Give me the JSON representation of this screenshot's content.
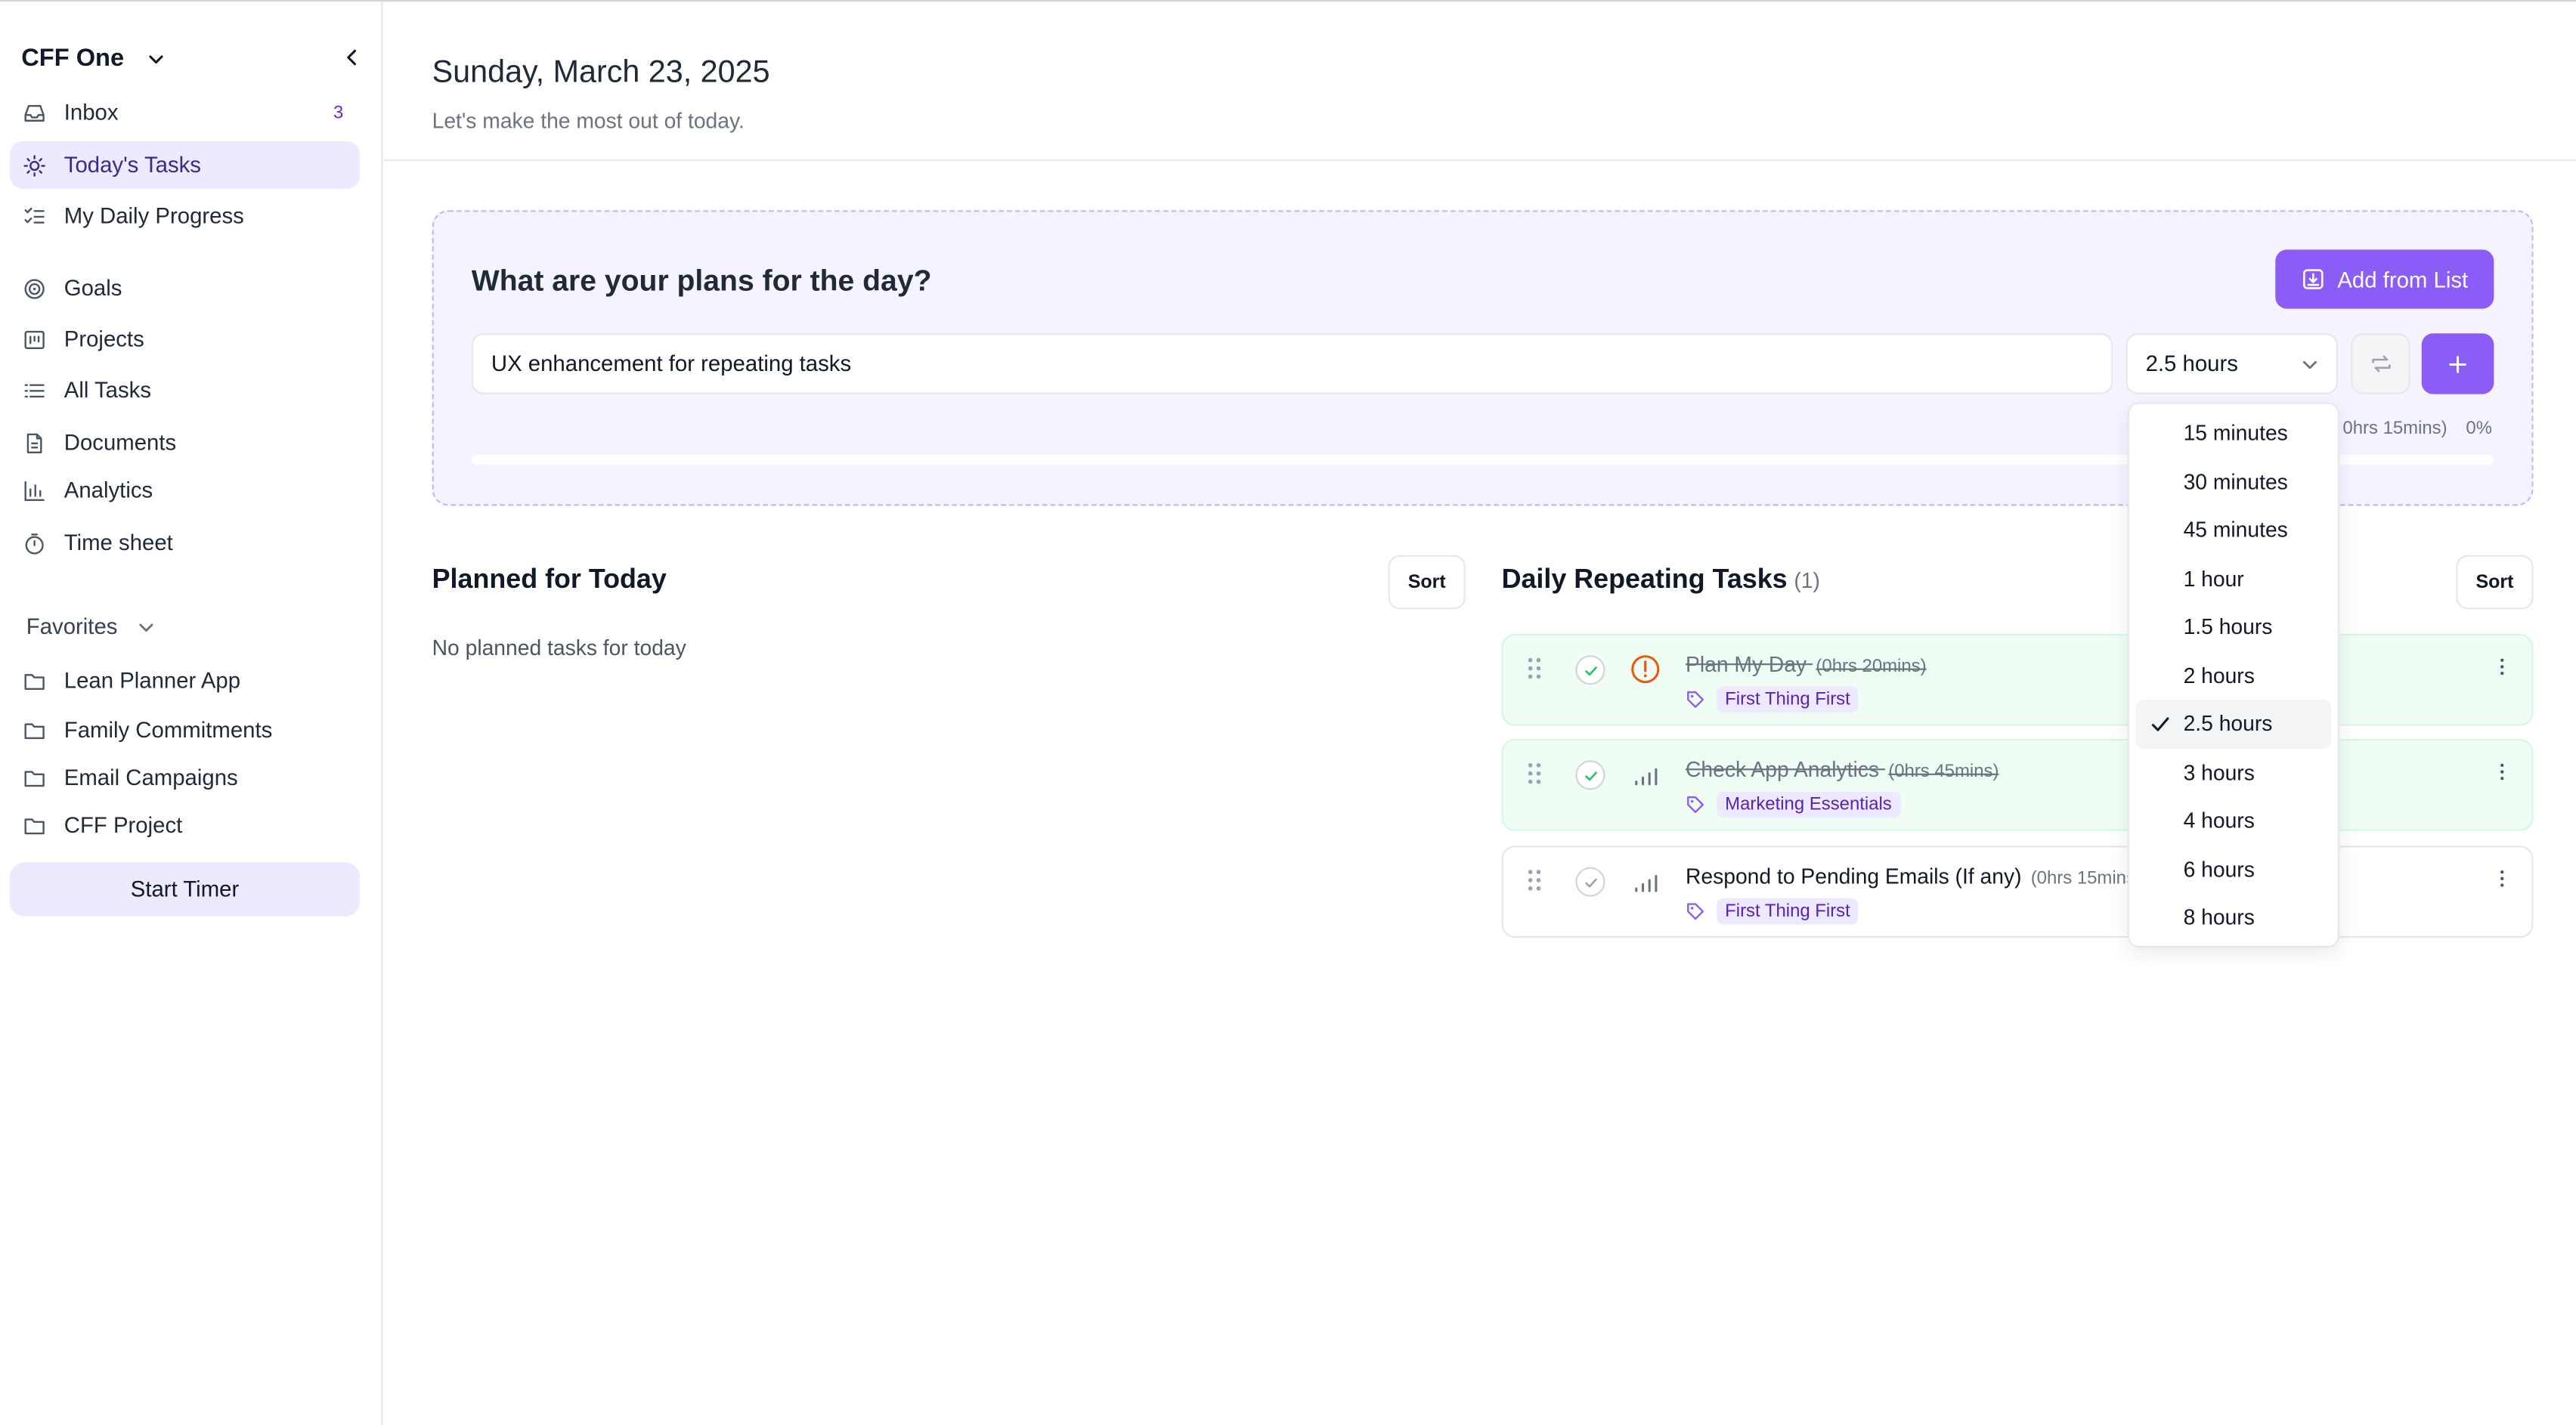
{
  "workspace": {
    "name": "CFF One"
  },
  "nav": [
    {
      "label": "Inbox",
      "icon": "inbox-icon",
      "badge": "3"
    },
    {
      "label": "Today's Tasks",
      "icon": "sun-icon",
      "active": true
    },
    {
      "label": "My Daily Progress",
      "icon": "checklist-icon"
    },
    {
      "label": "Goals",
      "icon": "target-icon"
    },
    {
      "label": "Projects",
      "icon": "kanban-icon"
    },
    {
      "label": "All Tasks",
      "icon": "list-icon"
    },
    {
      "label": "Documents",
      "icon": "document-icon"
    },
    {
      "label": "Analytics",
      "icon": "bar-chart-icon"
    },
    {
      "label": "Time sheet",
      "icon": "timer-icon"
    }
  ],
  "favorites": {
    "label": "Favorites",
    "items": [
      "Lean Planner App",
      "Family Commitments",
      "Email Campaigns",
      "CFF Project"
    ]
  },
  "start_timer": "Start Timer",
  "header": {
    "date": "Sunday, March 23, 2025",
    "subtitle": "Let's make the most out of today."
  },
  "plan": {
    "title": "What are your plans for the day?",
    "add_from_list": "Add from List",
    "input_value": "UX enhancement for repeating tasks",
    "duration": "2.5 hours",
    "progress_text": "0hrs 15mins)",
    "progress_pct": "0%",
    "progress_fraction": 0
  },
  "planned": {
    "title": "Planned for Today",
    "sort": "Sort",
    "empty": "No planned tasks for today"
  },
  "repeating": {
    "title": "Daily Repeating Tasks",
    "count": "(1)",
    "sort": "Sort",
    "tasks": [
      {
        "title": "Plan My Day",
        "duration": "(0hrs 20mins)",
        "tag": "First Thing First",
        "done": true,
        "priority": "urgent"
      },
      {
        "title": "Check App Analytics",
        "duration": "(0hrs 45mins)",
        "tag": "Marketing Essentials",
        "done": true,
        "priority": "low"
      },
      {
        "title": "Respond to Pending Emails (If any)",
        "duration": "(0hrs 15mins)",
        "tag": "First Thing First",
        "done": false,
        "priority": "low"
      }
    ]
  },
  "duration_options": [
    "15 minutes",
    "30 minutes",
    "45 minutes",
    "1 hour",
    "1.5 hours",
    "2 hours",
    "2.5 hours",
    "3 hours",
    "4 hours",
    "6 hours",
    "8 hours"
  ],
  "selected_duration": "2.5 hours",
  "colors": {
    "accent": "#8b5cf6",
    "accent_light": "#ede9fe",
    "done_bg": "#f0fdf4",
    "urgent": "#ea580c"
  }
}
